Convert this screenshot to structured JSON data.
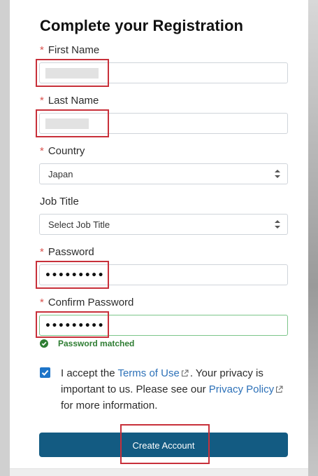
{
  "form": {
    "title": "Complete your Registration",
    "required_mark": "*",
    "first_name": {
      "label": "First Name"
    },
    "last_name": {
      "label": "Last Name"
    },
    "country": {
      "label": "Country",
      "value": "Japan"
    },
    "job_title": {
      "label": "Job Title",
      "value": "Select Job Title"
    },
    "password": {
      "label": "Password",
      "value": "•••••••••"
    },
    "confirm_password": {
      "label": "Confirm Password",
      "value": "•••••••••"
    },
    "password_status": "Password matched",
    "terms": {
      "checked": true,
      "text_1": "I accept the ",
      "terms_link": "Terms of Use",
      "text_2": ". Your privacy is important to us. Please see our ",
      "privacy_link": "Privacy Policy",
      "text_3": " for more information."
    },
    "submit_label": "Create Account"
  },
  "colors": {
    "button": "#135b82",
    "link": "#2d71b8",
    "required": "#d9534f",
    "success": "#2e7d32",
    "highlight": "#c8303a",
    "checkbox": "#1d74c8"
  }
}
